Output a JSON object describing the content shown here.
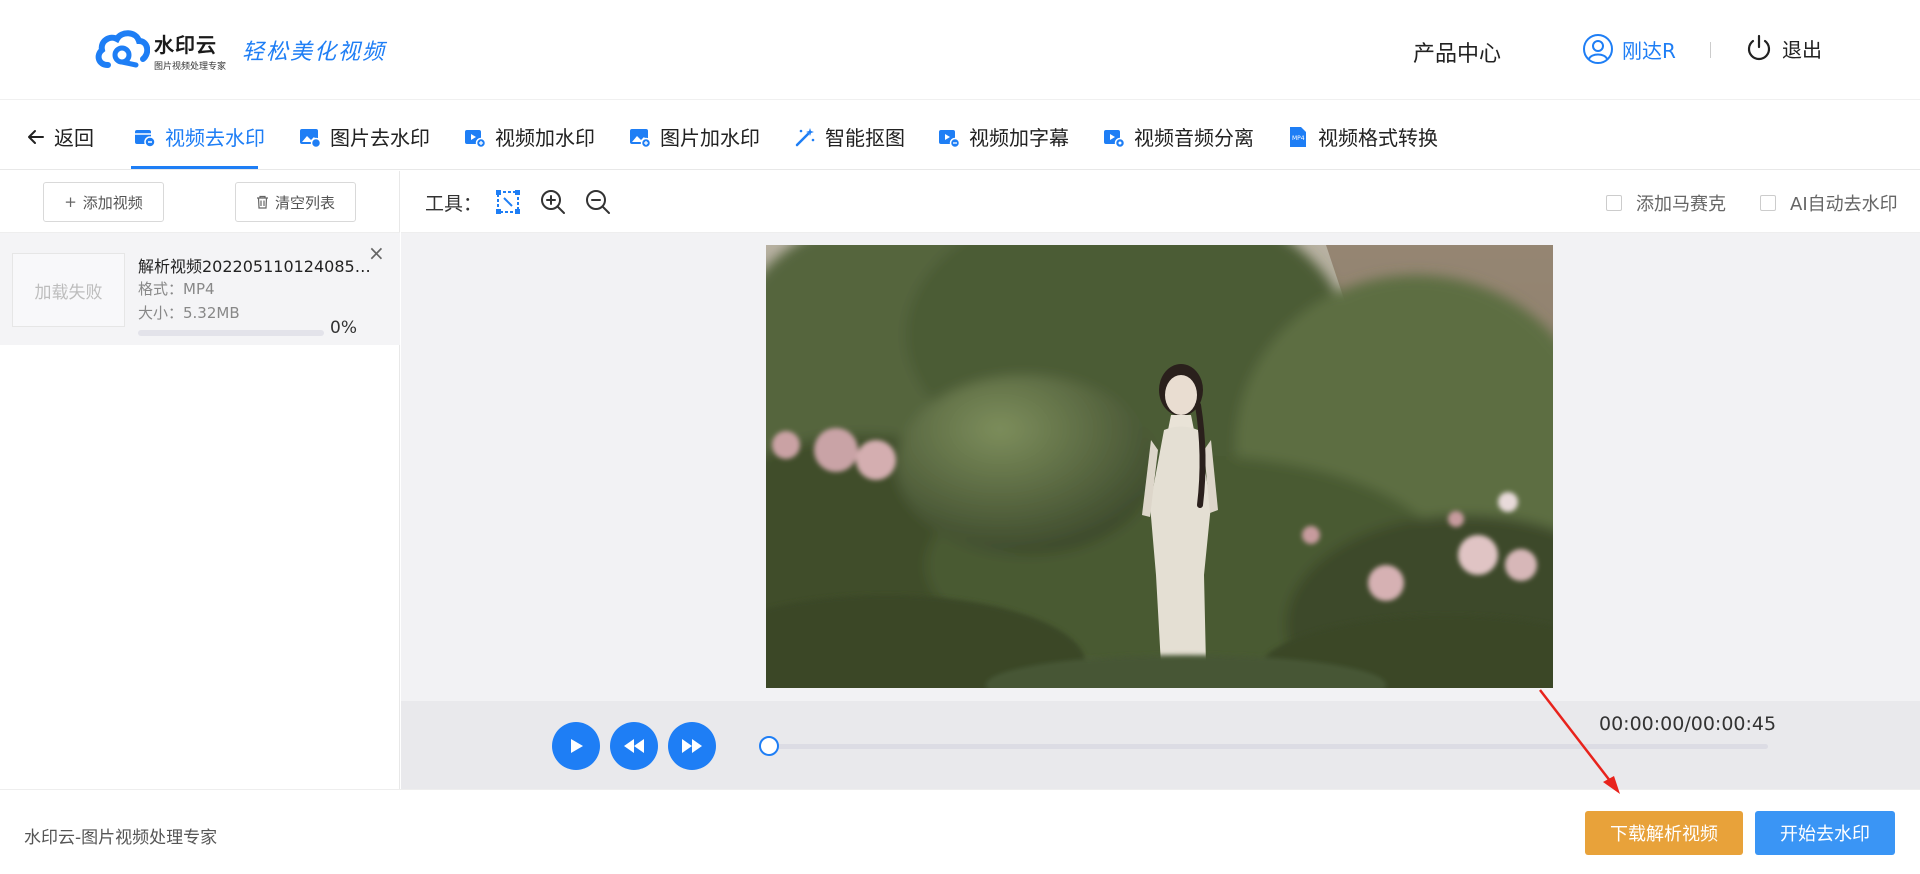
{
  "header": {
    "logo_name": "水印云",
    "logo_sub": "图片视频处理专家",
    "logo_slogan": "轻松美化视频",
    "product_center": "产品中心",
    "user_name": "刚达R",
    "logout": "退出"
  },
  "nav": {
    "back": "返回",
    "tabs": [
      {
        "label": "视频去水印",
        "icon": "video-eraser-icon",
        "active": true
      },
      {
        "label": "图片去水印",
        "icon": "image-eraser-icon",
        "active": false
      },
      {
        "label": "视频加水印",
        "icon": "video-add-icon",
        "active": false
      },
      {
        "label": "图片加水印",
        "icon": "image-add-icon",
        "active": false
      },
      {
        "label": "智能抠图",
        "icon": "magic-wand-icon",
        "active": false
      },
      {
        "label": "视频加字幕",
        "icon": "video-subtitle-icon",
        "active": false
      },
      {
        "label": "视频音频分离",
        "icon": "video-audio-split-icon",
        "active": false
      },
      {
        "label": "视频格式转换",
        "icon": "mp4-format-icon",
        "active": false
      }
    ]
  },
  "left_panel": {
    "add_video": "添加视频",
    "clear_list": "清空列表",
    "file": {
      "thumb_status": "加载失败",
      "name": "解析视频20220511012408511...",
      "format": "格式：MP4",
      "size": "大小：5.32MB",
      "progress": 0,
      "progress_text": "0%"
    }
  },
  "tools": {
    "label": "工具：",
    "add_mosaic": "添加马赛克",
    "ai_remove": "AI自动去水印"
  },
  "player": {
    "time": "00:00:00/00:00:45",
    "position": 0
  },
  "footer": {
    "brand": "水印云-图片视频处理专家",
    "download": "下载解析视频",
    "start": "开始去水印"
  },
  "colors": {
    "accent": "#1e7ef5",
    "download_button": "#e8a23a",
    "start_button": "#3a95f5",
    "annotation_arrow": "#e8231c"
  }
}
